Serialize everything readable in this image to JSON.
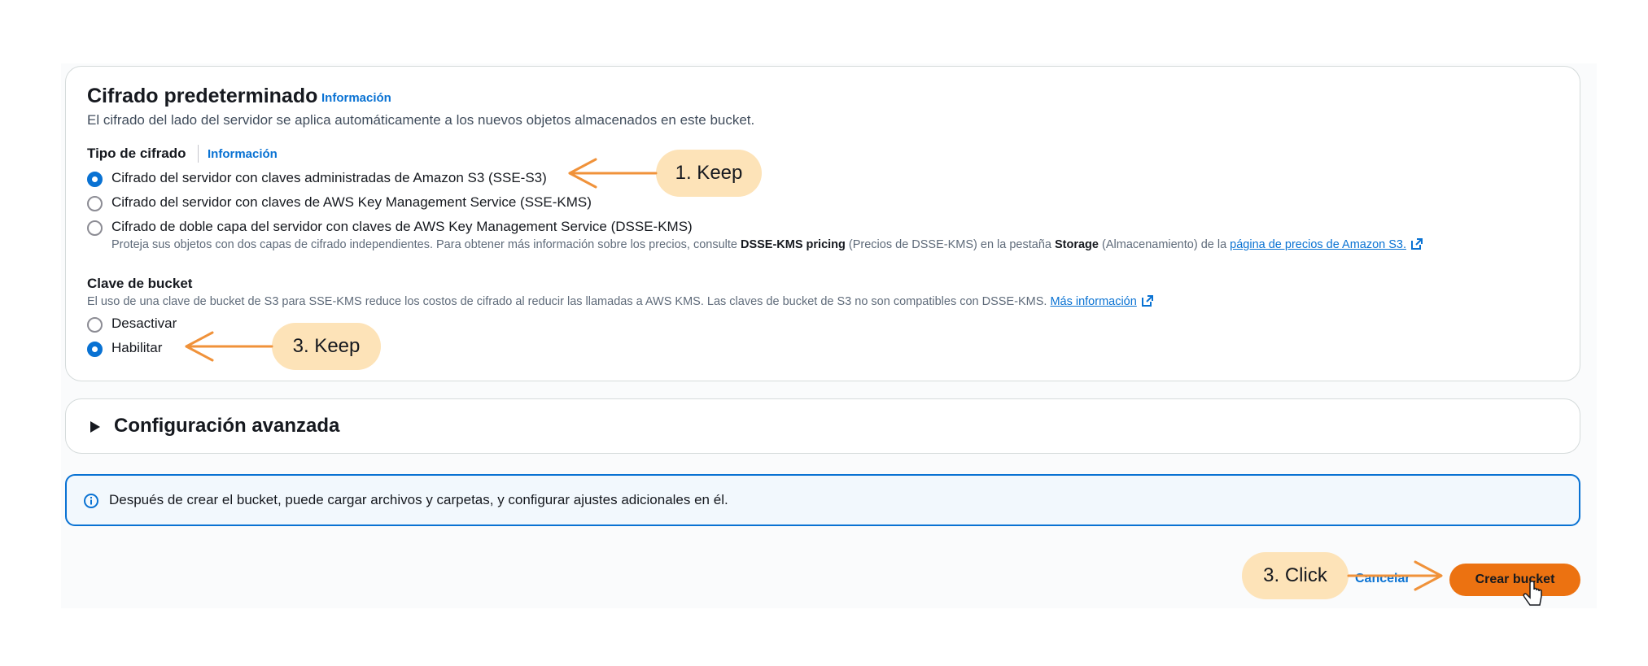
{
  "encryption": {
    "title": "Cifrado predeterminado",
    "info_link": "Información",
    "description": "El cifrado del lado del servidor se aplica automáticamente a los nuevos objetos almacenados en este bucket.",
    "type_label": "Tipo de cifrado",
    "type_info_link": "Información",
    "options": [
      {
        "label": "Cifrado del servidor con claves administradas de Amazon S3 (SSE-S3)",
        "selected": true
      },
      {
        "label": "Cifrado del servidor con claves de AWS Key Management Service (SSE-KMS)",
        "selected": false
      },
      {
        "label": "Cifrado de doble capa del servidor con claves de AWS Key Management Service (DSSE-KMS)",
        "selected": false
      }
    ],
    "dsse_hint": {
      "part1": "Proteja sus objetos con dos capas de cifrado independientes. Para obtener más información sobre los precios, consulte ",
      "bold1": "DSSE-KMS pricing",
      "part2": " (Precios de DSSE-KMS) en la pestaña ",
      "bold2": "Storage",
      "part3": " (Almacenamiento) de la ",
      "link": "página de precios de Amazon S3."
    }
  },
  "bucket_key": {
    "label": "Clave de bucket",
    "description": "El uso de una clave de bucket de S3 para SSE-KMS reduce los costos de cifrado al reducir las llamadas a AWS KMS. Las claves de bucket de S3 no son compatibles con DSSE-KMS.",
    "more_info_link": "Más información",
    "options": [
      {
        "label": "Desactivar",
        "selected": false
      },
      {
        "label": "Habilitar",
        "selected": true
      }
    ]
  },
  "advanced": {
    "title": "Configuración avanzada",
    "expanded": false
  },
  "alert": {
    "text": "Después de crear el bucket, puede cargar archivos y carpetas, y configurar ajustes adicionales en él."
  },
  "actions": {
    "cancel_label": "Cancelar",
    "create_label": "Crear bucket"
  },
  "annotations": {
    "keep_encryption": "1. Keep",
    "keep_bucket_key": "3. Keep",
    "click_create": "3. Click"
  },
  "colors": {
    "accent_blue": "#0972d3",
    "primary_button": "#ec7211",
    "callout_bg": "#fde3b8",
    "arrow": "#f0923a"
  },
  "icons": [
    "info-icon",
    "external-link-icon",
    "caret-right-icon",
    "hand-cursor-icon"
  ]
}
